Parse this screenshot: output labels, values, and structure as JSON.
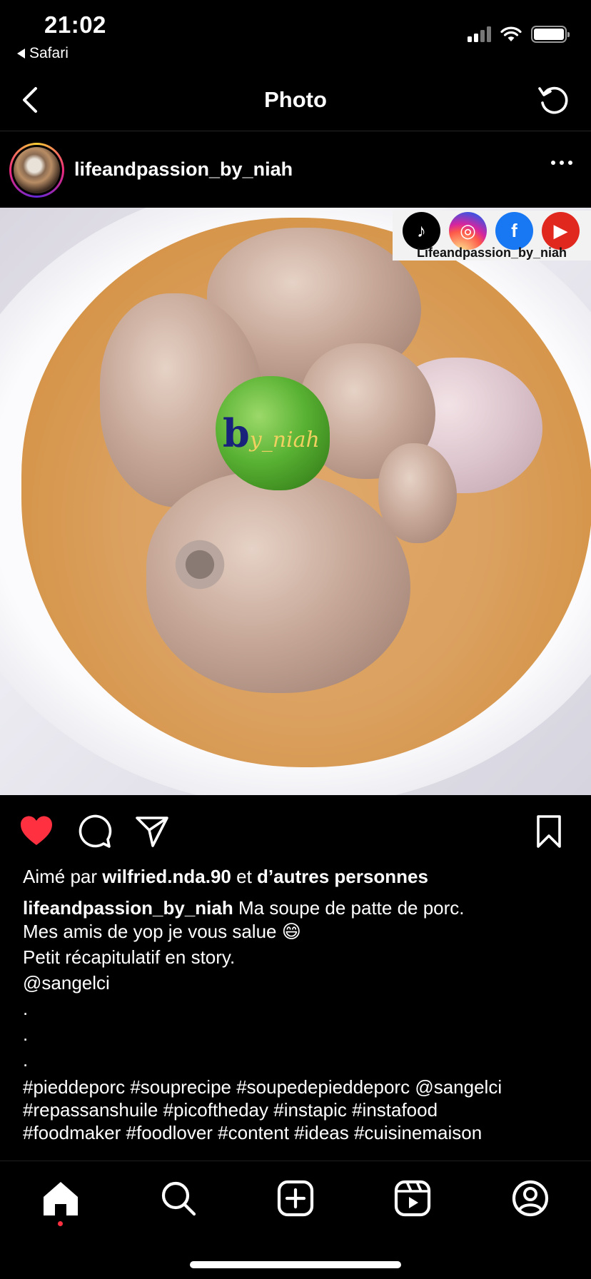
{
  "status_bar": {
    "time": "21:02",
    "back_app": "Safari",
    "icons": [
      "cellular-signal-icon",
      "wifi-icon",
      "battery-icon"
    ]
  },
  "header": {
    "title": "Photo",
    "back_icon": "chevron-left-icon",
    "refresh_icon": "refresh-icon"
  },
  "post": {
    "username": "lifeandpassion_by_niah",
    "more_icon": "more-horizontal-icon",
    "photo": {
      "watermark_text": "y_niah",
      "watermark_initial": "b",
      "social_handle": "Lifeandpassion_by_niah",
      "social_icons": [
        "tiktok-icon",
        "instagram-icon",
        "facebook-icon",
        "youtube-icon"
      ]
    },
    "actions": {
      "liked": true,
      "like_color": "#ff3040"
    },
    "likes": {
      "prefix": "Aimé par",
      "user": "wilfried.nda.90",
      "middle": "et",
      "others": "d’autres personnes"
    },
    "caption": {
      "user": "lifeandpassion_by_niah",
      "first_line": " Ma soupe de patte de porc.",
      "body": "Mes amis de yop je vous salue 😄\nPetit récapitulatif en story.\n@sangelci\n.\n.\n.",
      "hashtags": "#pieddeporc #souprecipe #soupedepieddeporc @sangelci\n#repassanshuile #picoftheday #instapic #instafood\n#foodmaker #foodlover #content #ideas #cuisinemaison"
    }
  },
  "tabbar": {
    "tabs": [
      "home-icon",
      "search-icon",
      "create-post-icon",
      "reels-icon",
      "profile-icon"
    ],
    "active": "home-icon",
    "notification_dot_color": "#ff3040"
  }
}
